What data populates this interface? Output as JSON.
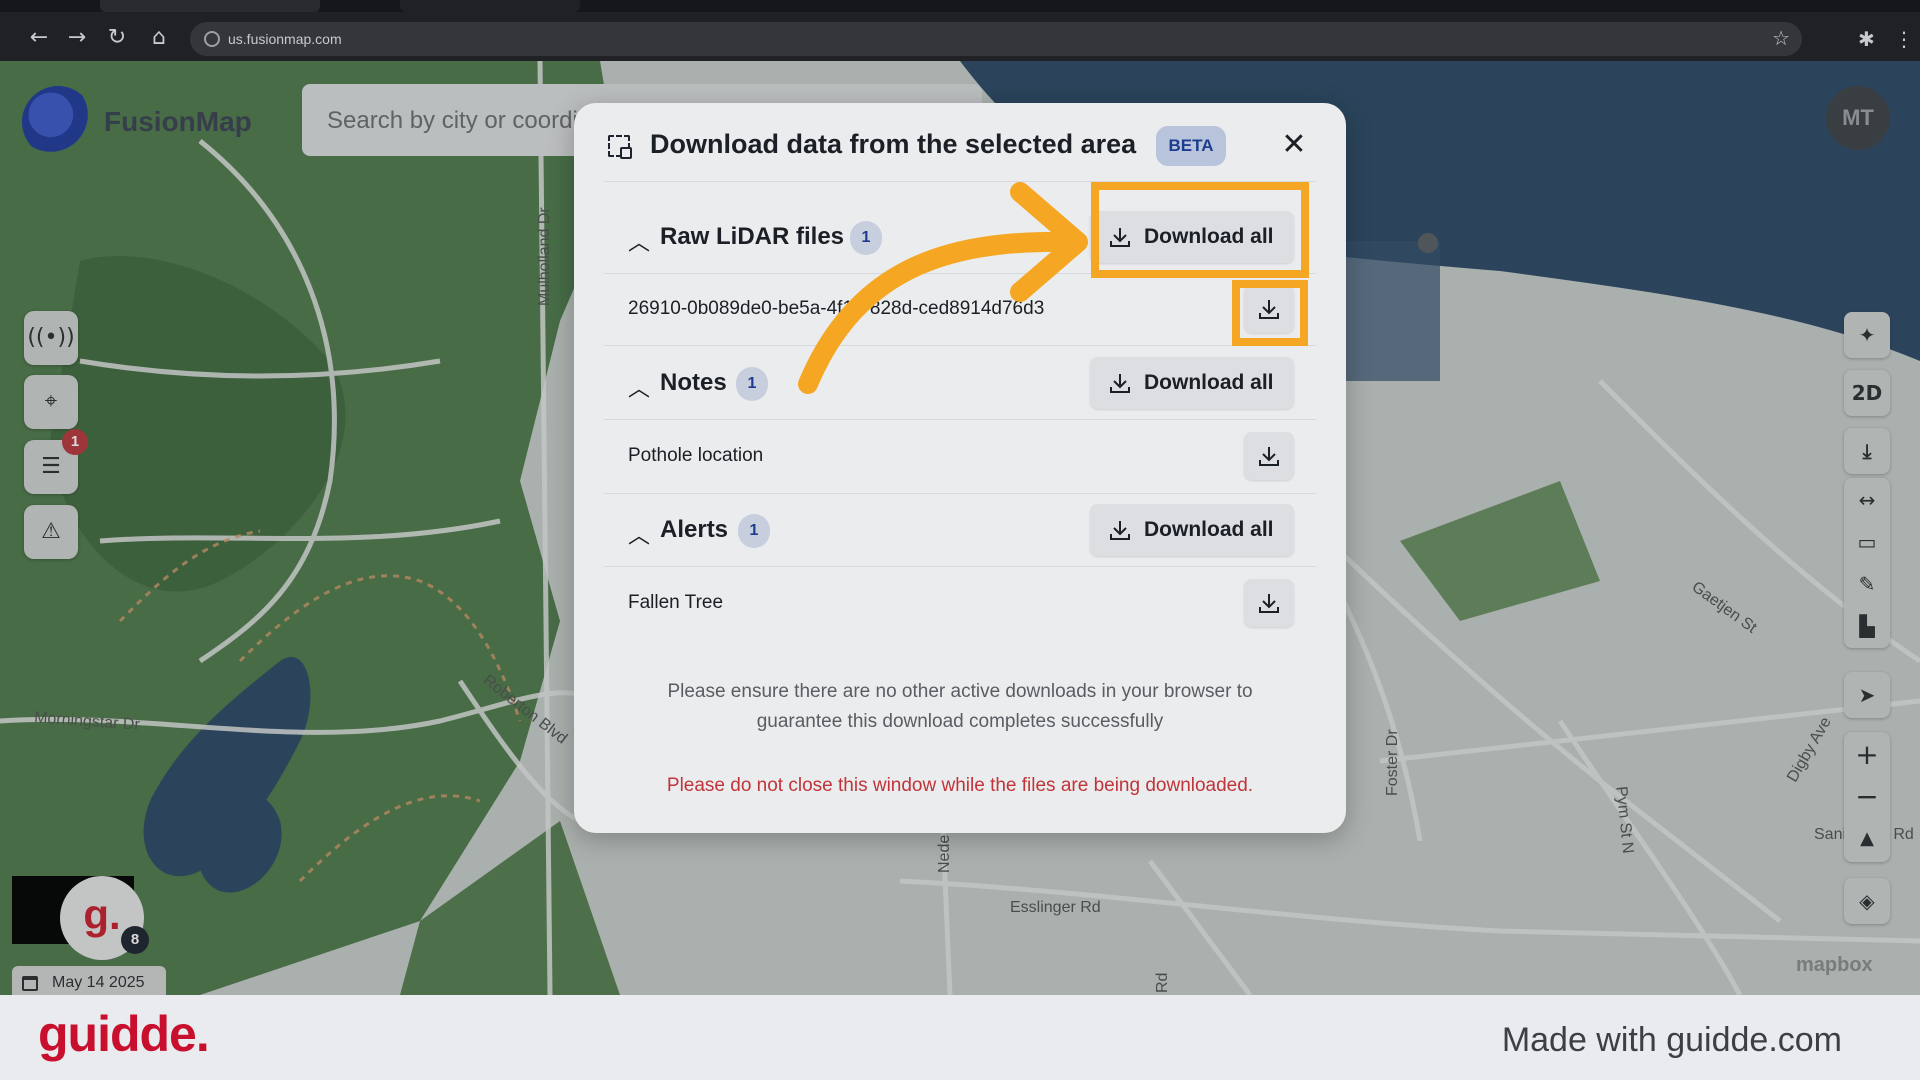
{
  "browser": {
    "url": "us.fusionmap.com",
    "icons": [
      "back-arrow-icon",
      "forward-arrow-icon",
      "reload-icon",
      "home-icon",
      "site-info-icon",
      "bookmark-star-icon",
      "extensions-icon",
      "kebab-menu-icon"
    ]
  },
  "app": {
    "logo_text": "FusionMap",
    "search_placeholder": "Search by city or coordinates",
    "user_initials": "MT",
    "notes_badge": "1",
    "date": "May 14 2025",
    "guidde_avatar": "g.",
    "guidde_count": "8",
    "mapbox": "mapbox"
  },
  "map_labels": {
    "mulholland": "Mulholland Dr",
    "morningstar": "Morningstar Dr",
    "roberton": "Roberton Blvd",
    "esslinger": "Esslinger Rd",
    "gaetjen": "Gaetjen St",
    "digby": "Digby Ave",
    "foster": "Foster Dr",
    "pym": "Pym St N",
    "nede": "Nede",
    "sani": "Sani",
    "n_rd": "n Rd",
    "rd": "Rd"
  },
  "map_tools": {
    "left": [
      "broadcast-icon",
      "scan-target-icon",
      "notes-list-icon",
      "alert-triangle-icon"
    ],
    "right_top": [
      "ai-sparkle-icon",
      "2D",
      "download-icon"
    ],
    "right_group": [
      "split-arrows-icon",
      "ruler-icon",
      "pin-edit-icon",
      "chart-icon"
    ],
    "right_mid": [
      "navigate-arrow-icon"
    ],
    "zoom": [
      "+",
      "−",
      "▲"
    ],
    "layers": "layers-icon"
  },
  "modal": {
    "title": "Download data from the selected area",
    "badge": "BETA",
    "sections": [
      {
        "title": "Raw LiDAR files",
        "count": "1",
        "download_all": "Download all",
        "items": [
          "26910-0b089de0-be5a-4f16-828d-ced8914d76d3"
        ]
      },
      {
        "title": "Notes",
        "count": "1",
        "download_all": "Download all",
        "items": [
          "Pothole location"
        ]
      },
      {
        "title": "Alerts",
        "count": "1",
        "download_all": "Download all",
        "items": [
          "Fallen Tree"
        ]
      }
    ],
    "info": "Please ensure there are no other active downloads in your browser to guarantee this download completes successfully",
    "warning": "Please do not close this window while the files are being downloaded."
  },
  "footer": {
    "brand": "guidde.",
    "made_with": "Made with guidde.com"
  },
  "colors": {
    "highlight": "#f5a623",
    "warning": "#c0343a",
    "badge_blue": "#1d3c8f",
    "guidde_red": "#c8102e"
  }
}
